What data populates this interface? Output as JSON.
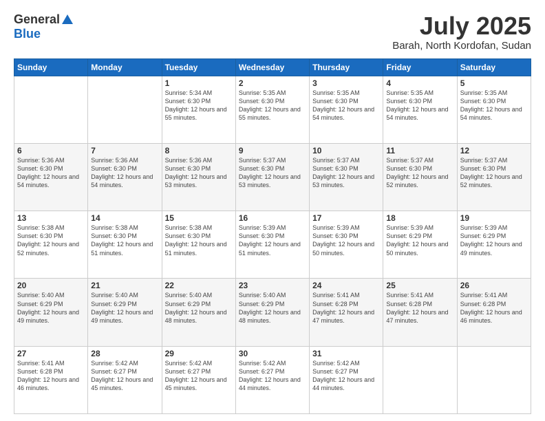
{
  "logo": {
    "general": "General",
    "blue": "Blue"
  },
  "title": "July 2025",
  "subtitle": "Barah, North Kordofan, Sudan",
  "days_of_week": [
    "Sunday",
    "Monday",
    "Tuesday",
    "Wednesday",
    "Thursday",
    "Friday",
    "Saturday"
  ],
  "weeks": [
    [
      {
        "day": "",
        "sunrise": "",
        "sunset": "",
        "daylight": ""
      },
      {
        "day": "",
        "sunrise": "",
        "sunset": "",
        "daylight": ""
      },
      {
        "day": "1",
        "sunrise": "Sunrise: 5:34 AM",
        "sunset": "Sunset: 6:30 PM",
        "daylight": "Daylight: 12 hours and 55 minutes."
      },
      {
        "day": "2",
        "sunrise": "Sunrise: 5:35 AM",
        "sunset": "Sunset: 6:30 PM",
        "daylight": "Daylight: 12 hours and 55 minutes."
      },
      {
        "day": "3",
        "sunrise": "Sunrise: 5:35 AM",
        "sunset": "Sunset: 6:30 PM",
        "daylight": "Daylight: 12 hours and 54 minutes."
      },
      {
        "day": "4",
        "sunrise": "Sunrise: 5:35 AM",
        "sunset": "Sunset: 6:30 PM",
        "daylight": "Daylight: 12 hours and 54 minutes."
      },
      {
        "day": "5",
        "sunrise": "Sunrise: 5:35 AM",
        "sunset": "Sunset: 6:30 PM",
        "daylight": "Daylight: 12 hours and 54 minutes."
      }
    ],
    [
      {
        "day": "6",
        "sunrise": "Sunrise: 5:36 AM",
        "sunset": "Sunset: 6:30 PM",
        "daylight": "Daylight: 12 hours and 54 minutes."
      },
      {
        "day": "7",
        "sunrise": "Sunrise: 5:36 AM",
        "sunset": "Sunset: 6:30 PM",
        "daylight": "Daylight: 12 hours and 54 minutes."
      },
      {
        "day": "8",
        "sunrise": "Sunrise: 5:36 AM",
        "sunset": "Sunset: 6:30 PM",
        "daylight": "Daylight: 12 hours and 53 minutes."
      },
      {
        "day": "9",
        "sunrise": "Sunrise: 5:37 AM",
        "sunset": "Sunset: 6:30 PM",
        "daylight": "Daylight: 12 hours and 53 minutes."
      },
      {
        "day": "10",
        "sunrise": "Sunrise: 5:37 AM",
        "sunset": "Sunset: 6:30 PM",
        "daylight": "Daylight: 12 hours and 53 minutes."
      },
      {
        "day": "11",
        "sunrise": "Sunrise: 5:37 AM",
        "sunset": "Sunset: 6:30 PM",
        "daylight": "Daylight: 12 hours and 52 minutes."
      },
      {
        "day": "12",
        "sunrise": "Sunrise: 5:37 AM",
        "sunset": "Sunset: 6:30 PM",
        "daylight": "Daylight: 12 hours and 52 minutes."
      }
    ],
    [
      {
        "day": "13",
        "sunrise": "Sunrise: 5:38 AM",
        "sunset": "Sunset: 6:30 PM",
        "daylight": "Daylight: 12 hours and 52 minutes."
      },
      {
        "day": "14",
        "sunrise": "Sunrise: 5:38 AM",
        "sunset": "Sunset: 6:30 PM",
        "daylight": "Daylight: 12 hours and 51 minutes."
      },
      {
        "day": "15",
        "sunrise": "Sunrise: 5:38 AM",
        "sunset": "Sunset: 6:30 PM",
        "daylight": "Daylight: 12 hours and 51 minutes."
      },
      {
        "day": "16",
        "sunrise": "Sunrise: 5:39 AM",
        "sunset": "Sunset: 6:30 PM",
        "daylight": "Daylight: 12 hours and 51 minutes."
      },
      {
        "day": "17",
        "sunrise": "Sunrise: 5:39 AM",
        "sunset": "Sunset: 6:30 PM",
        "daylight": "Daylight: 12 hours and 50 minutes."
      },
      {
        "day": "18",
        "sunrise": "Sunrise: 5:39 AM",
        "sunset": "Sunset: 6:29 PM",
        "daylight": "Daylight: 12 hours and 50 minutes."
      },
      {
        "day": "19",
        "sunrise": "Sunrise: 5:39 AM",
        "sunset": "Sunset: 6:29 PM",
        "daylight": "Daylight: 12 hours and 49 minutes."
      }
    ],
    [
      {
        "day": "20",
        "sunrise": "Sunrise: 5:40 AM",
        "sunset": "Sunset: 6:29 PM",
        "daylight": "Daylight: 12 hours and 49 minutes."
      },
      {
        "day": "21",
        "sunrise": "Sunrise: 5:40 AM",
        "sunset": "Sunset: 6:29 PM",
        "daylight": "Daylight: 12 hours and 49 minutes."
      },
      {
        "day": "22",
        "sunrise": "Sunrise: 5:40 AM",
        "sunset": "Sunset: 6:29 PM",
        "daylight": "Daylight: 12 hours and 48 minutes."
      },
      {
        "day": "23",
        "sunrise": "Sunrise: 5:40 AM",
        "sunset": "Sunset: 6:29 PM",
        "daylight": "Daylight: 12 hours and 48 minutes."
      },
      {
        "day": "24",
        "sunrise": "Sunrise: 5:41 AM",
        "sunset": "Sunset: 6:28 PM",
        "daylight": "Daylight: 12 hours and 47 minutes."
      },
      {
        "day": "25",
        "sunrise": "Sunrise: 5:41 AM",
        "sunset": "Sunset: 6:28 PM",
        "daylight": "Daylight: 12 hours and 47 minutes."
      },
      {
        "day": "26",
        "sunrise": "Sunrise: 5:41 AM",
        "sunset": "Sunset: 6:28 PM",
        "daylight": "Daylight: 12 hours and 46 minutes."
      }
    ],
    [
      {
        "day": "27",
        "sunrise": "Sunrise: 5:41 AM",
        "sunset": "Sunset: 6:28 PM",
        "daylight": "Daylight: 12 hours and 46 minutes."
      },
      {
        "day": "28",
        "sunrise": "Sunrise: 5:42 AM",
        "sunset": "Sunset: 6:27 PM",
        "daylight": "Daylight: 12 hours and 45 minutes."
      },
      {
        "day": "29",
        "sunrise": "Sunrise: 5:42 AM",
        "sunset": "Sunset: 6:27 PM",
        "daylight": "Daylight: 12 hours and 45 minutes."
      },
      {
        "day": "30",
        "sunrise": "Sunrise: 5:42 AM",
        "sunset": "Sunset: 6:27 PM",
        "daylight": "Daylight: 12 hours and 44 minutes."
      },
      {
        "day": "31",
        "sunrise": "Sunrise: 5:42 AM",
        "sunset": "Sunset: 6:27 PM",
        "daylight": "Daylight: 12 hours and 44 minutes."
      },
      {
        "day": "",
        "sunrise": "",
        "sunset": "",
        "daylight": ""
      },
      {
        "day": "",
        "sunrise": "",
        "sunset": "",
        "daylight": ""
      }
    ]
  ]
}
